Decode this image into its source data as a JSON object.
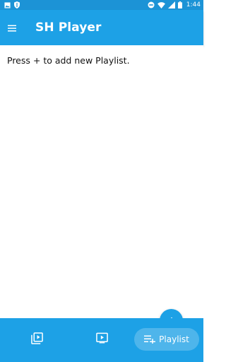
{
  "status_bar": {
    "left_icons": [
      "image-icon",
      "shield-icon"
    ],
    "right_icons": [
      "minus-circle-icon",
      "wifi-icon",
      "signal-icon",
      "battery-icon"
    ],
    "time": "1:44"
  },
  "app_bar": {
    "menu_icon": "hamburger-menu-icon",
    "title": "SH Player"
  },
  "main": {
    "empty_message": "Press + to add new Playlist."
  },
  "fab": {
    "icon": "plus-icon",
    "label": "+"
  },
  "bottom_nav": {
    "items": [
      {
        "icon": "video-library-icon",
        "label": "",
        "selected": false
      },
      {
        "icon": "video-player-icon",
        "label": "",
        "selected": false
      },
      {
        "icon": "playlist-add-icon",
        "label": "Playlist",
        "selected": true
      }
    ]
  },
  "colors": {
    "primary": "#1da1e6",
    "status_bar": "#1c93d6",
    "on_primary": "#ffffff",
    "text": "#111111"
  }
}
